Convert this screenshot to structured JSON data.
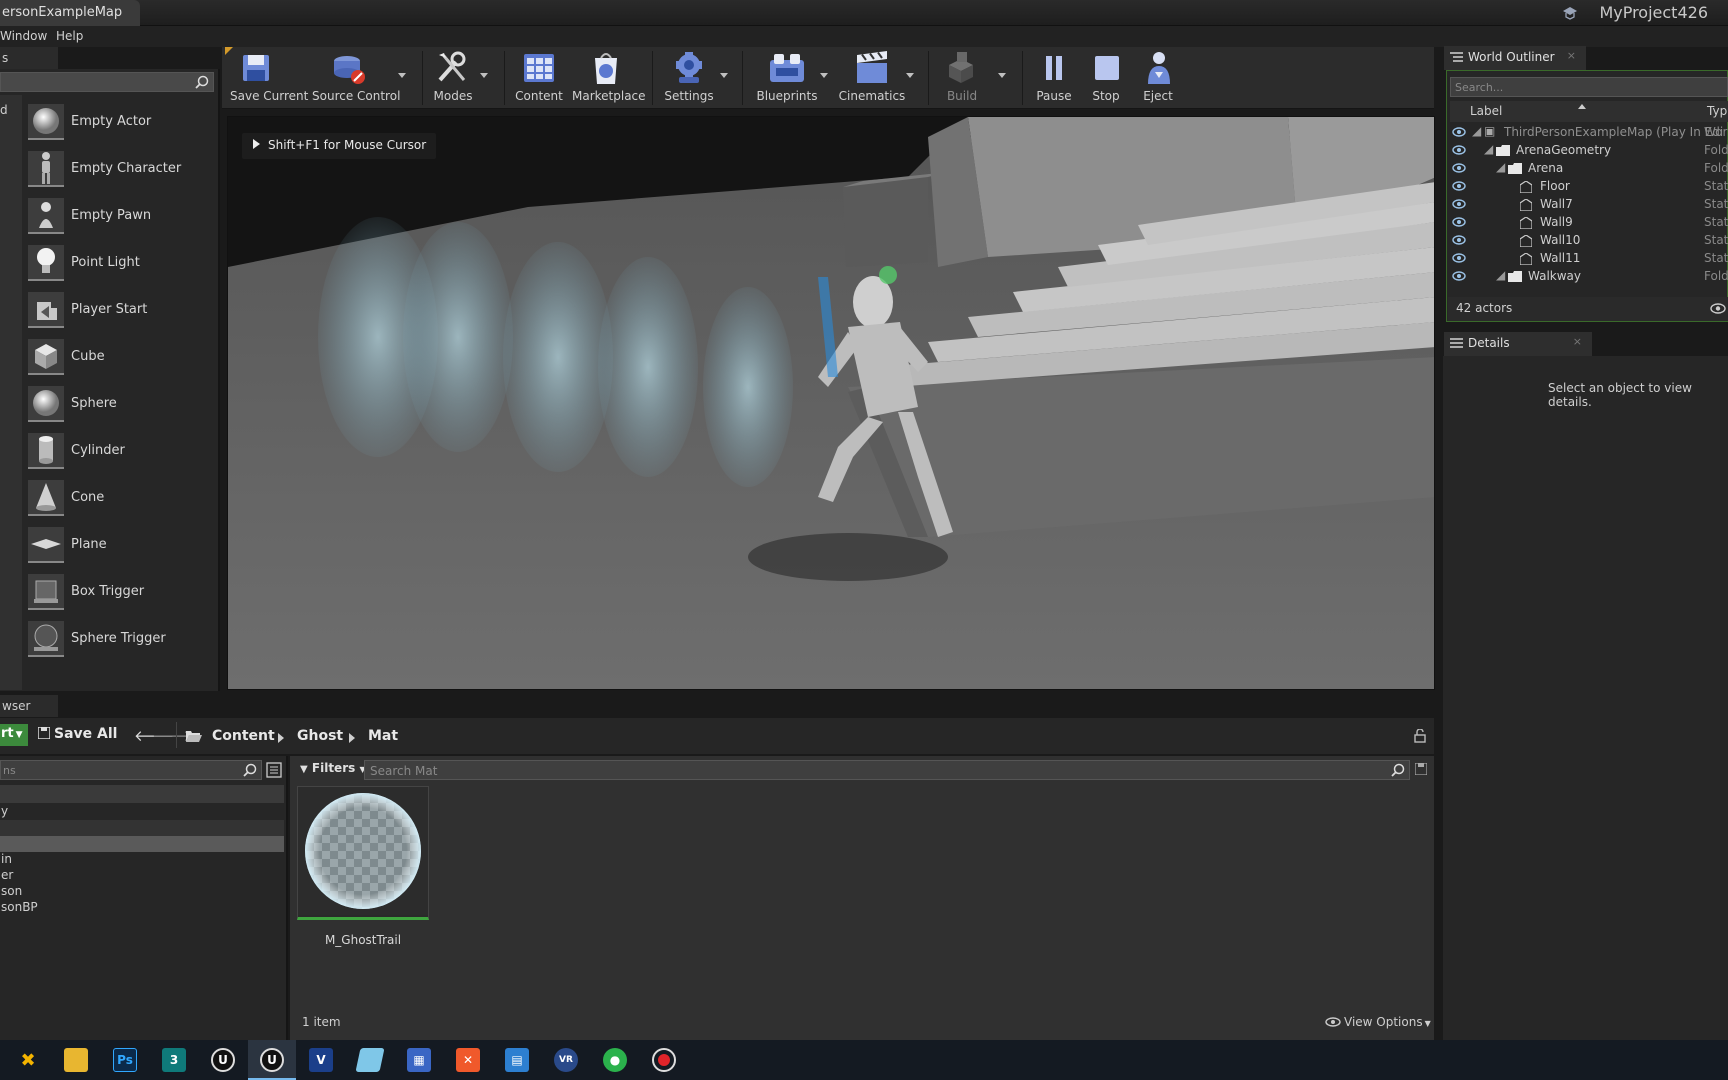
{
  "title_bar": {
    "doc_tab": "ersonExampleMap",
    "project_name": "MyProject426"
  },
  "menu": {
    "window": "Window",
    "help": "Help"
  },
  "modes_panel": {
    "tab_label": "s",
    "category_label": "d",
    "items": [
      {
        "label": "Empty Actor",
        "icon": "sphere-icon"
      },
      {
        "label": "Empty Character",
        "icon": "character-icon"
      },
      {
        "label": "Empty Pawn",
        "icon": "pawn-icon"
      },
      {
        "label": "Point Light",
        "icon": "light-bulb-icon"
      },
      {
        "label": "Player Start",
        "icon": "player-start-icon"
      },
      {
        "label": "Cube",
        "icon": "cube-icon"
      },
      {
        "label": "Sphere",
        "icon": "sphere-icon"
      },
      {
        "label": "Cylinder",
        "icon": "cylinder-icon"
      },
      {
        "label": "Cone",
        "icon": "cone-icon"
      },
      {
        "label": "Plane",
        "icon": "plane-icon"
      },
      {
        "label": "Box Trigger",
        "icon": "box-trigger-icon"
      },
      {
        "label": "Sphere Trigger",
        "icon": "sphere-trigger-icon"
      }
    ]
  },
  "toolbar": {
    "save_current": "Save Current",
    "source_control": "Source Control",
    "modes": "Modes",
    "content": "Content",
    "marketplace": "Marketplace",
    "settings": "Settings",
    "blueprints": "Blueprints",
    "cinematics": "Cinematics",
    "build": "Build",
    "pause": "Pause",
    "stop": "Stop",
    "eject": "Eject"
  },
  "viewport": {
    "hint": "Shift+F1 for Mouse Cursor"
  },
  "world_outliner": {
    "tab_label": "World Outliner",
    "search_placeholder": "Search...",
    "col_label": "Label",
    "col_type": "Typ",
    "rows": [
      {
        "label": "ThirdPersonExampleMap (Play In Edi",
        "type": "Worl"
      },
      {
        "label": "ArenaGeometry",
        "type": "Fold"
      },
      {
        "label": "Arena",
        "type": "Fold"
      },
      {
        "label": "Floor",
        "type": "Stati"
      },
      {
        "label": "Wall7",
        "type": "Stati"
      },
      {
        "label": "Wall9",
        "type": "Stati"
      },
      {
        "label": "Wall10",
        "type": "Stati"
      },
      {
        "label": "Wall11",
        "type": "Stati"
      },
      {
        "label": "Walkway",
        "type": "Fold"
      }
    ],
    "actor_count": "42 actors"
  },
  "details": {
    "tab_label": "Details",
    "empty_message": "Select an object to view details."
  },
  "content_browser": {
    "tab_label": "wser",
    "import_label": "rt",
    "save_all": "Save All",
    "breadcrumbs": [
      "Content",
      "Ghost",
      "Mat"
    ],
    "filters_label": "Filters",
    "search_placeholder": "Search Mat",
    "sources_search": "ns",
    "sources": [
      "y",
      "",
      "in",
      "er",
      "son",
      "sonBP"
    ],
    "assets": [
      {
        "name": "M_GhostTrail"
      }
    ],
    "item_count": "1 item",
    "view_options": "View Options"
  },
  "taskbar": {
    "apps": [
      "tools-icon",
      "folder-icon",
      "photoshop-icon",
      "3dsmax-icon",
      "unreal-icon",
      "unreal-active-icon",
      "visio-icon",
      "notes-icon",
      "calculator-icon",
      "xmind-icon",
      "screenshot-icon",
      "vr-icon",
      "wechat-icon",
      "record-icon"
    ]
  }
}
